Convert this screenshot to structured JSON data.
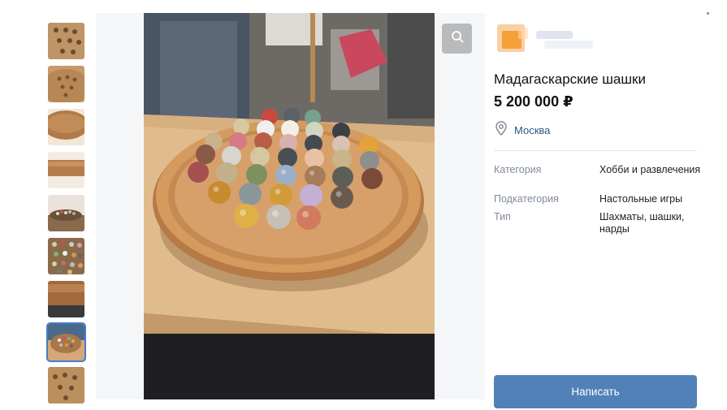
{
  "thumbnails": [
    {
      "label": "photo-1"
    },
    {
      "label": "photo-2"
    },
    {
      "label": "photo-3"
    },
    {
      "label": "photo-4"
    },
    {
      "label": "photo-5"
    },
    {
      "label": "photo-6"
    },
    {
      "label": "photo-7"
    },
    {
      "label": "photo-8",
      "selected": true
    },
    {
      "label": "photo-9"
    }
  ],
  "zoom_icon": "search-icon",
  "listing": {
    "title": "Мадагаскарские шашки",
    "price": "5 200 000 ₽",
    "location": "Москва",
    "location_icon": "location-pin-icon"
  },
  "properties": [
    {
      "label": "Категория",
      "value": "Хобби и развлечения"
    },
    {
      "label": "Подкатегория",
      "value": "Настольные игры"
    },
    {
      "label": "Тип",
      "value": "Шахматы, шашки, нарды"
    }
  ],
  "write_button": "Написать",
  "colors": {
    "accent": "#5181b8",
    "link": "#2a5885",
    "muted": "#818c99"
  }
}
